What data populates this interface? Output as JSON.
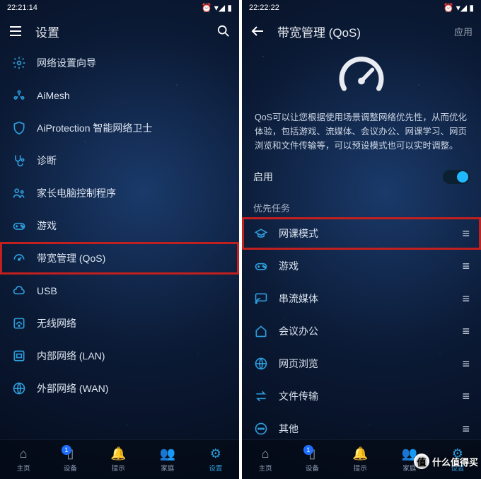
{
  "left": {
    "status_time": "22:21:14",
    "header_title": "设置",
    "items": [
      {
        "label": "网络设置向导"
      },
      {
        "label": "AiMesh"
      },
      {
        "label": "AiProtection 智能网络卫士"
      },
      {
        "label": "诊断"
      },
      {
        "label": "家长电脑控制程序"
      },
      {
        "label": "游戏"
      },
      {
        "label": "带宽管理 (QoS)"
      },
      {
        "label": "USB"
      },
      {
        "label": "无线网络"
      },
      {
        "label": "内部网络 (LAN)"
      },
      {
        "label": "外部网络 (WAN)"
      }
    ],
    "nav": {
      "home": "主页",
      "devices": "设备",
      "alerts": "提示",
      "family": "家庭",
      "settings": "设置",
      "badge": "1"
    }
  },
  "right": {
    "status_time": "22:22:22",
    "header_title": "带宽管理 (QoS)",
    "apply_label": "应用",
    "description": "QoS可以让您根据使用场景调整网络优先性，从而优化体验，包括游戏、流媒体、会议办公、网课学习、网页浏览和文件传输等，可以预设模式也可以实时调整。",
    "enable_label": "启用",
    "priority_label": "优先任务",
    "tasks": [
      {
        "label": "网课模式"
      },
      {
        "label": "游戏"
      },
      {
        "label": "串流媒体"
      },
      {
        "label": "会议办公"
      },
      {
        "label": "网页浏览"
      },
      {
        "label": "文件传输"
      },
      {
        "label": "其他"
      }
    ],
    "nav": {
      "home": "主页",
      "devices": "设备",
      "alerts": "提示",
      "family": "家庭",
      "settings": "设置",
      "badge": "1"
    }
  },
  "watermark": "什么值得买"
}
